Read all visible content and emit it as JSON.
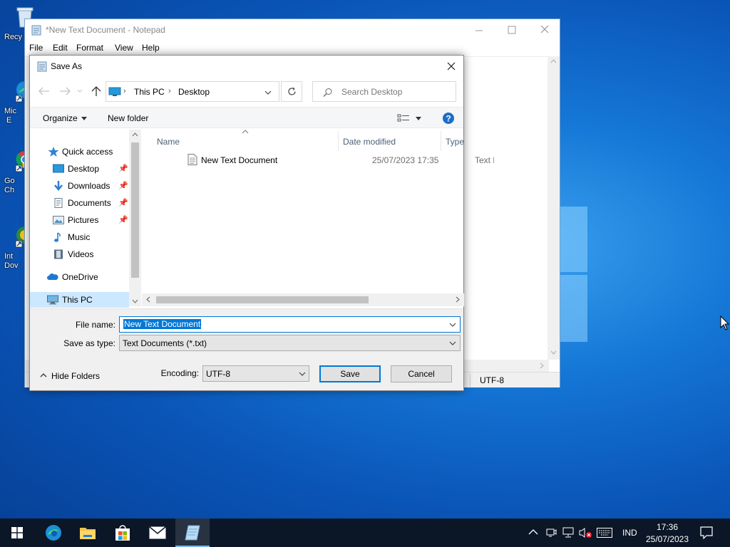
{
  "desktop": {
    "icons": [
      {
        "label": "Recy",
        "icon": "recycle-bin-icon"
      },
      {
        "label": "Mic\n E",
        "icon": "edge-shortcut-icon"
      },
      {
        "label": "Go\nCh",
        "icon": "chrome-shortcut-icon"
      },
      {
        "label": "Int\nDov",
        "icon": "idm-shortcut-icon"
      }
    ]
  },
  "notepad": {
    "title": "*New Text Document - Notepad",
    "menu": [
      "File",
      "Edit",
      "Format",
      "View",
      "Help"
    ],
    "status_encoding": "UTF-8"
  },
  "dialog": {
    "title": "Save As",
    "breadcrumb": [
      "This PC",
      "Desktop"
    ],
    "search_placeholder": "Search Desktop",
    "toolbar": {
      "organize": "Organize",
      "new_folder": "New folder"
    },
    "nav_items": [
      {
        "label": "Quick access",
        "icon": "star-icon",
        "pinned": false
      },
      {
        "label": "Desktop",
        "icon": "desktop-folder-icon",
        "pinned": true
      },
      {
        "label": "Downloads",
        "icon": "download-arrow-icon",
        "pinned": true
      },
      {
        "label": "Documents",
        "icon": "documents-icon",
        "pinned": true
      },
      {
        "label": "Pictures",
        "icon": "pictures-icon",
        "pinned": true
      },
      {
        "label": "Music",
        "icon": "music-note-icon",
        "pinned": false
      },
      {
        "label": "Videos",
        "icon": "film-icon",
        "pinned": false
      },
      {
        "label": "OneDrive",
        "icon": "cloud-icon",
        "pinned": false
      },
      {
        "label": "This PC",
        "icon": "computer-icon",
        "pinned": false
      }
    ],
    "columns": {
      "name": "Name",
      "date": "Date modified",
      "type": "Type"
    },
    "files": [
      {
        "name": "New Text Document",
        "date": "25/07/2023 17:35",
        "type": "Text D"
      }
    ],
    "file_name_label": "File name:",
    "file_name_value": "New Text Document",
    "save_type_label": "Save as type:",
    "save_type_value": "Text Documents (*.txt)",
    "hide_folders": "Hide Folders",
    "encoding_label": "Encoding:",
    "encoding_value": "UTF-8",
    "save_button": "Save",
    "cancel_button": "Cancel"
  },
  "taskbar": {
    "language": "IND",
    "time": "17:36",
    "date": "25/07/2023"
  },
  "colors": {
    "accent": "#0078d7",
    "selection": "#cce8ff",
    "taskbar": "#0b1626"
  }
}
